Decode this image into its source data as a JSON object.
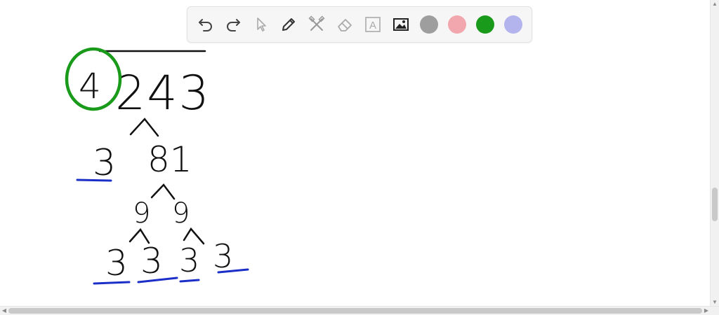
{
  "toolbar": {
    "tools": [
      {
        "name": "undo-icon"
      },
      {
        "name": "redo-icon"
      },
      {
        "name": "select-pointer-icon"
      },
      {
        "name": "pencil-icon"
      },
      {
        "name": "tools-icon"
      },
      {
        "name": "eraser-icon"
      },
      {
        "name": "text-icon"
      },
      {
        "name": "image-icon"
      }
    ],
    "text_tool_glyph": "A",
    "colors": [
      "#9e9e9e",
      "#f2a6ad",
      "#1a9a1a",
      "#b3b3ee"
    ]
  },
  "drawing": {
    "ink_color": "#111111",
    "underline_color": "#1b2fc8",
    "circle_color": "#1a9a1a",
    "dividend": "243",
    "circled_digit": "4",
    "factor_left": "3",
    "factor_right": "81",
    "level2": [
      "9",
      "9"
    ],
    "level3": [
      "3",
      "3",
      "3",
      "3"
    ]
  }
}
